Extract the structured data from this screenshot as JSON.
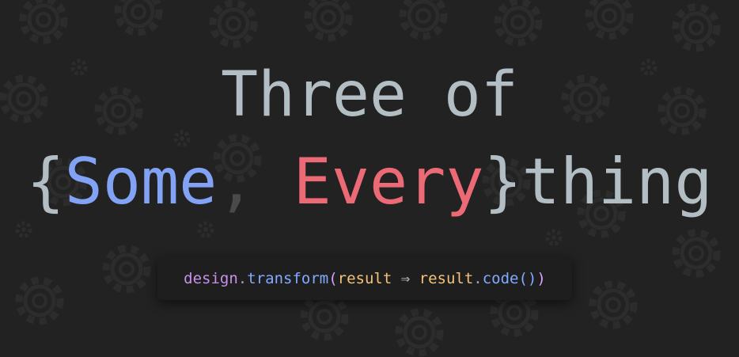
{
  "title": {
    "line1": "Three of",
    "open_brace": "{",
    "word_some": "Some",
    "comma": ",",
    "word_every": "Every",
    "close_brace": "}",
    "word_thing": "thing"
  },
  "code": {
    "object": "design",
    "dot1": ".",
    "method": "transform",
    "open_paren": "(",
    "param": "result",
    "arrow": " ⇒ ",
    "param2": "result",
    "dot2": ".",
    "call": "code",
    "call_parens": "()",
    "close_paren": ")"
  },
  "colors": {
    "background": "#222222",
    "title_gray": "#b2bec3",
    "some_blue": "#82a3f5",
    "every_red": "#ec6a76",
    "code_bg": "#1e1e1e"
  },
  "icons": [
    "gear-icon"
  ]
}
